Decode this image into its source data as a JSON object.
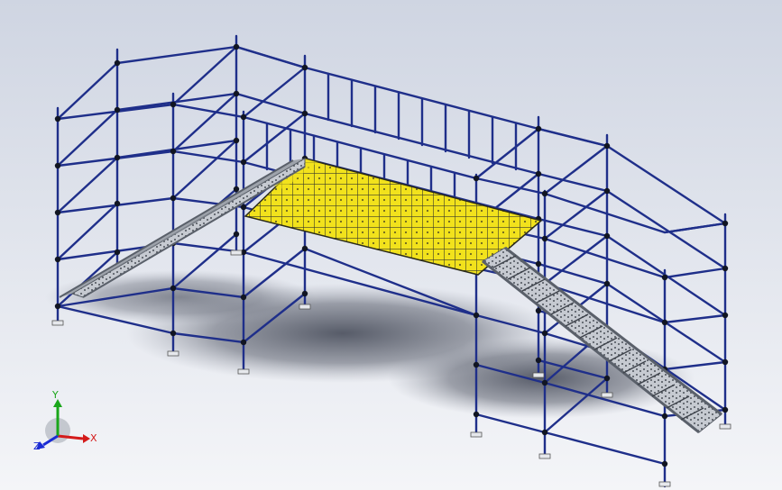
{
  "viewport": {
    "background_top": "#cfd5e2",
    "background_bottom": "#f4f5f8",
    "model": "scaffold-bridge-with-stairs"
  },
  "colors": {
    "scaffold_tube": "#1f2f8a",
    "coupler": "#111522",
    "deck": "#f2e21c",
    "deck_grid": "#3b3b2a",
    "stair_metal": "#b9bec6",
    "stair_dark": "#5a606a",
    "shadow": "#3d4250"
  },
  "triad": {
    "x_label": "X",
    "y_label": "Y",
    "z_label": "Z",
    "x_color": "#d41a1a",
    "y_color": "#1aa61a",
    "z_color": "#1a2bd4"
  }
}
